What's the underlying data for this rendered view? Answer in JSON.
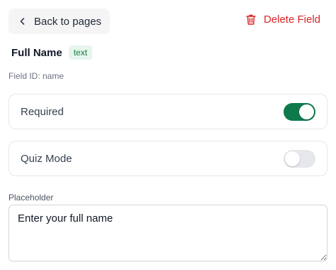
{
  "header": {
    "back_label": "Back to pages",
    "back_icon": "chevron-left-icon",
    "delete_label": "Delete Field",
    "delete_icon": "trash-icon",
    "delete_color": "#dc2626"
  },
  "field": {
    "name": "Full Name",
    "type": "text",
    "id_text": "Field ID: name"
  },
  "settings": {
    "required": {
      "label": "Required",
      "enabled": true
    },
    "quiz_mode": {
      "label": "Quiz Mode",
      "enabled": false
    }
  },
  "placeholder": {
    "label": "Placeholder",
    "value": "Enter your full name"
  },
  "colors": {
    "toggle_on": "#0e7a4c",
    "badge_bg": "#e7f5ec",
    "badge_text": "#15803d"
  }
}
